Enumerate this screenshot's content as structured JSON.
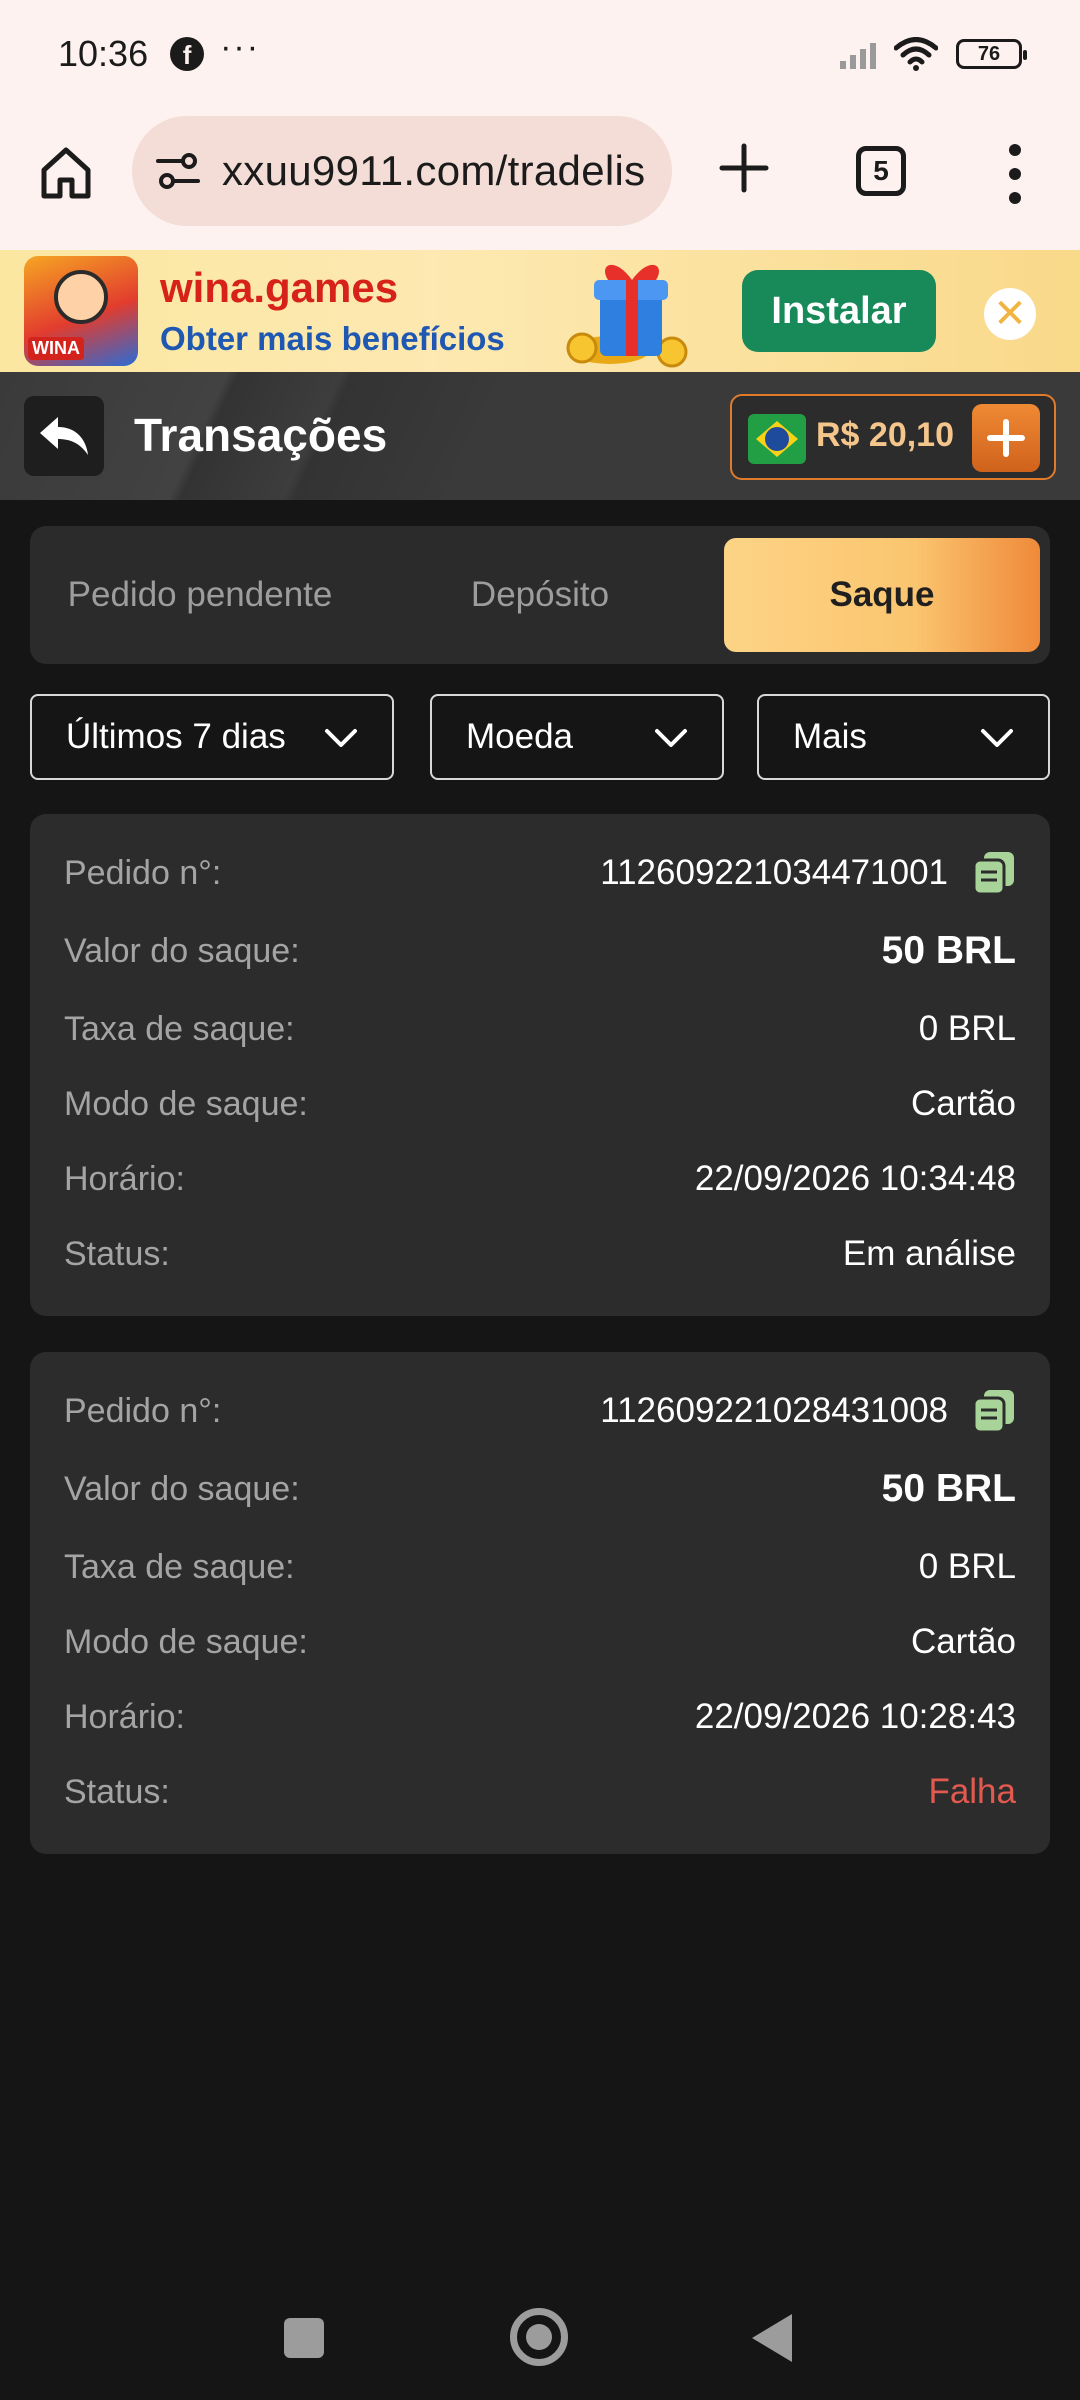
{
  "status_bar": {
    "time": "10:36",
    "facebook_glyph": "f",
    "more": "···",
    "battery": "76"
  },
  "browser": {
    "url": "xxuu9911.com/tradelis",
    "tab_count": "5"
  },
  "banner": {
    "title": "wina.games",
    "subtitle": "Obter mais benefícios",
    "install_label": "Instalar",
    "close_glyph": "✕",
    "logo_text": "WINA"
  },
  "header": {
    "title": "Transações",
    "balance": "R$ 20,10"
  },
  "tabs": {
    "pending": "Pedido pendente",
    "deposit": "Depósito",
    "withdraw": "Saque",
    "active": "withdraw"
  },
  "filters": {
    "period": "Últimos 7 dias",
    "currency": "Moeda",
    "more": "Mais"
  },
  "labels": {
    "order": "Pedido n°:",
    "amount": "Valor do saque:",
    "fee": "Taxa de saque:",
    "mode": "Modo de saque:",
    "time": "Horário:",
    "status": "Status:"
  },
  "transactions": [
    {
      "order_no": "112609221034471001",
      "amount": "50 BRL",
      "fee": "0 BRL",
      "mode": "Cartão",
      "time": "22/09/2026 10:34:48",
      "status": "Em análise"
    },
    {
      "order_no": "112609221028431008",
      "amount": "50 BRL",
      "fee": "0 BRL",
      "mode": "Cartão",
      "time": "22/09/2026 10:28:43",
      "status": "Falha"
    }
  ],
  "colors": {
    "accent_orange": "#ef8a3a",
    "tab_gold": "#fcd486",
    "status_failed": "#e2594f",
    "install_green": "#188a5a",
    "copy_icon_green": "#a8d49a"
  },
  "icons": {
    "home": "home-icon",
    "site_settings": "tune-icon",
    "new_tab": "plus-icon",
    "menu": "more-vert-icon",
    "back": "reply-arrow-icon",
    "add_balance": "plus-icon",
    "copy": "copy-icon",
    "dropdown": "chevron-down-icon"
  }
}
